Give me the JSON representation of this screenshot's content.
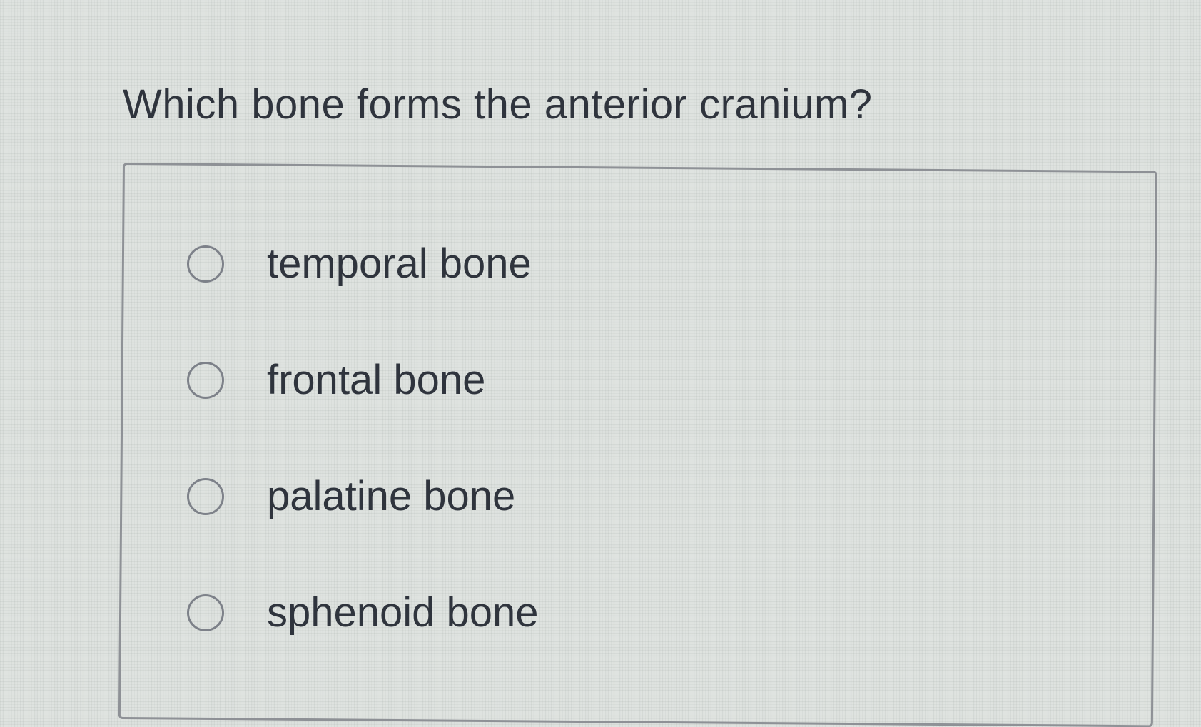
{
  "question": {
    "text": "Which bone forms the anterior cranium?"
  },
  "options": [
    {
      "label": "temporal bone",
      "selected": false
    },
    {
      "label": "frontal bone",
      "selected": false
    },
    {
      "label": "palatine bone",
      "selected": false
    },
    {
      "label": "sphenoid bone",
      "selected": false
    }
  ],
  "icons": {
    "radio": "radio-unselected-icon"
  }
}
